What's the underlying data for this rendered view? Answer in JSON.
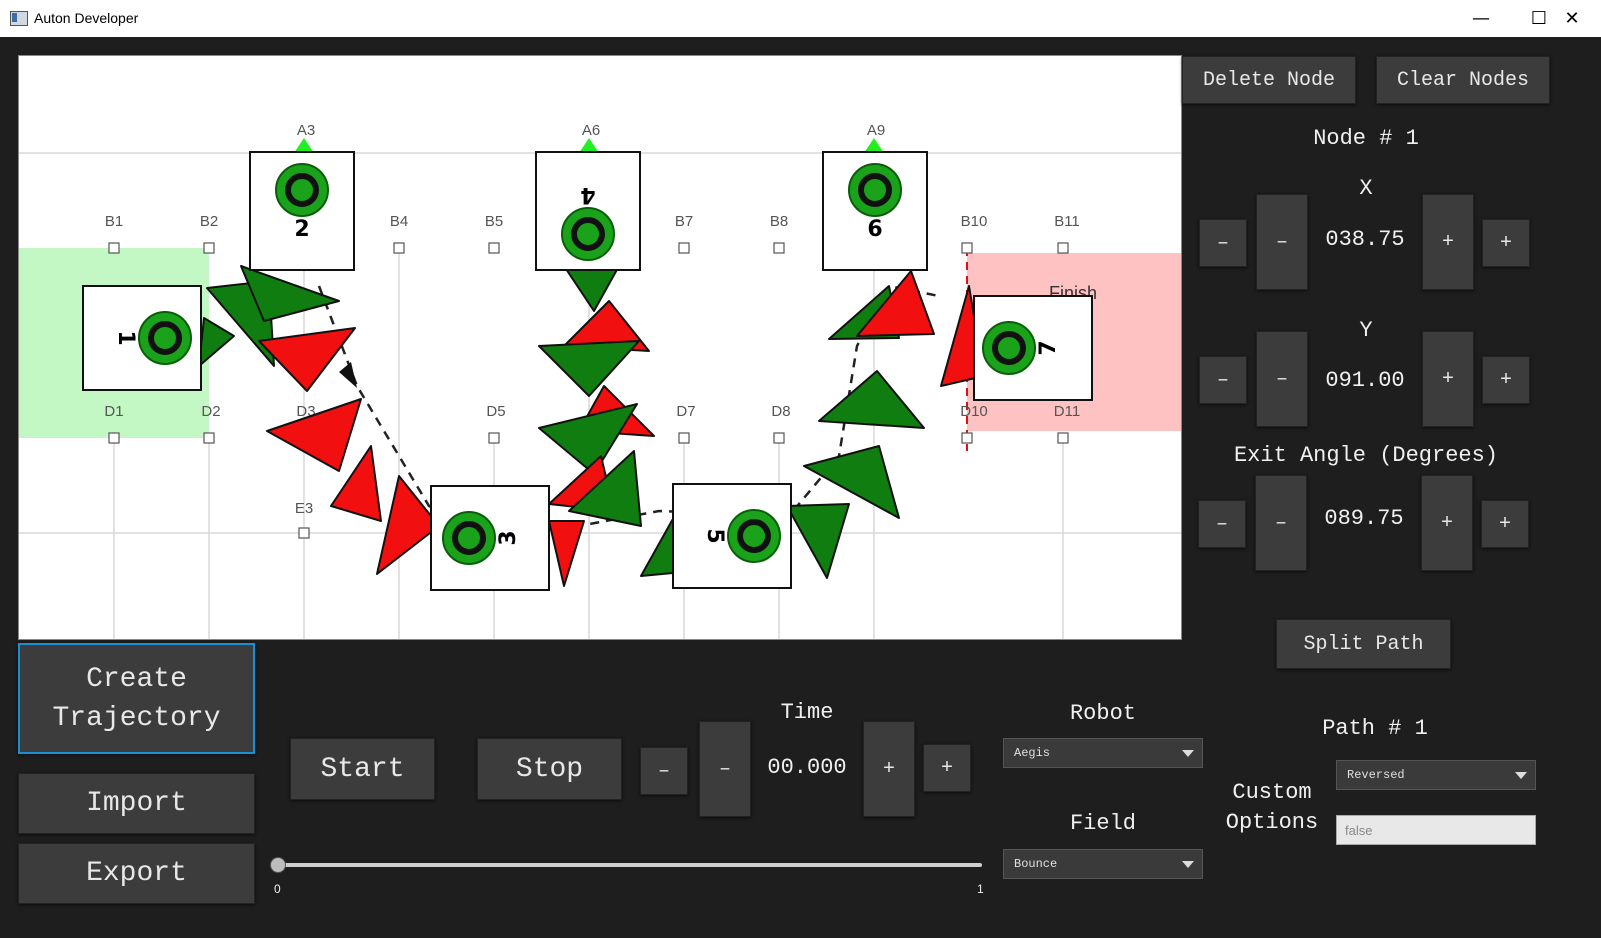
{
  "window": {
    "title": "Auton Developer",
    "minimize_glyph": "—",
    "maximize_glyph": "☐",
    "close_glyph": "✕"
  },
  "field": {
    "grid_labels": {
      "A3": "A3",
      "A6": "A6",
      "A9": "A9",
      "B1": "B1",
      "B2": "B2",
      "B4": "B4",
      "B5": "B5",
      "B7": "B7",
      "B8": "B8",
      "B10": "B10",
      "B11": "B11",
      "D1": "D1",
      "D2": "D2",
      "D3": "D3",
      "D5": "D5",
      "D7": "D7",
      "D8": "D8",
      "D10": "D10",
      "D11": "D11",
      "E3": "E3"
    },
    "finish_label": "Finish",
    "nodes": [
      "1",
      "2",
      "3",
      "4",
      "5",
      "6",
      "7"
    ],
    "colors": {
      "start_zone": "#c3f7c3",
      "finish_zone": "#ffc2c2",
      "green_arrow": "#0f7d0f",
      "red_arrow": "#f20f0f"
    }
  },
  "toolbar": {
    "delete_node": "Delete Node",
    "clear_nodes": "Clear Nodes",
    "split_path": "Split Path"
  },
  "node": {
    "title": "Node # 1",
    "x_label": "X",
    "x_value": "038.75",
    "y_label": "Y",
    "y_value": "091.00",
    "angle_label": "Exit Angle (Degrees)",
    "angle_value": "089.75",
    "minus": "–",
    "plus": "+"
  },
  "actions": {
    "create_trajectory": "Create\nTrajectory",
    "import": "Import",
    "export": "Export",
    "start": "Start",
    "stop": "Stop"
  },
  "time": {
    "label": "Time",
    "value": "00.000",
    "slider_min": "0",
    "slider_max": "1",
    "slider_position": 0
  },
  "robot": {
    "label": "Robot",
    "selected": "Aegis"
  },
  "field_select": {
    "label": "Field",
    "selected": "Bounce"
  },
  "path": {
    "title": "Path # 1",
    "custom_options_label": "Custom\nOptions",
    "option_selected": "Reversed",
    "option_value": "false"
  }
}
